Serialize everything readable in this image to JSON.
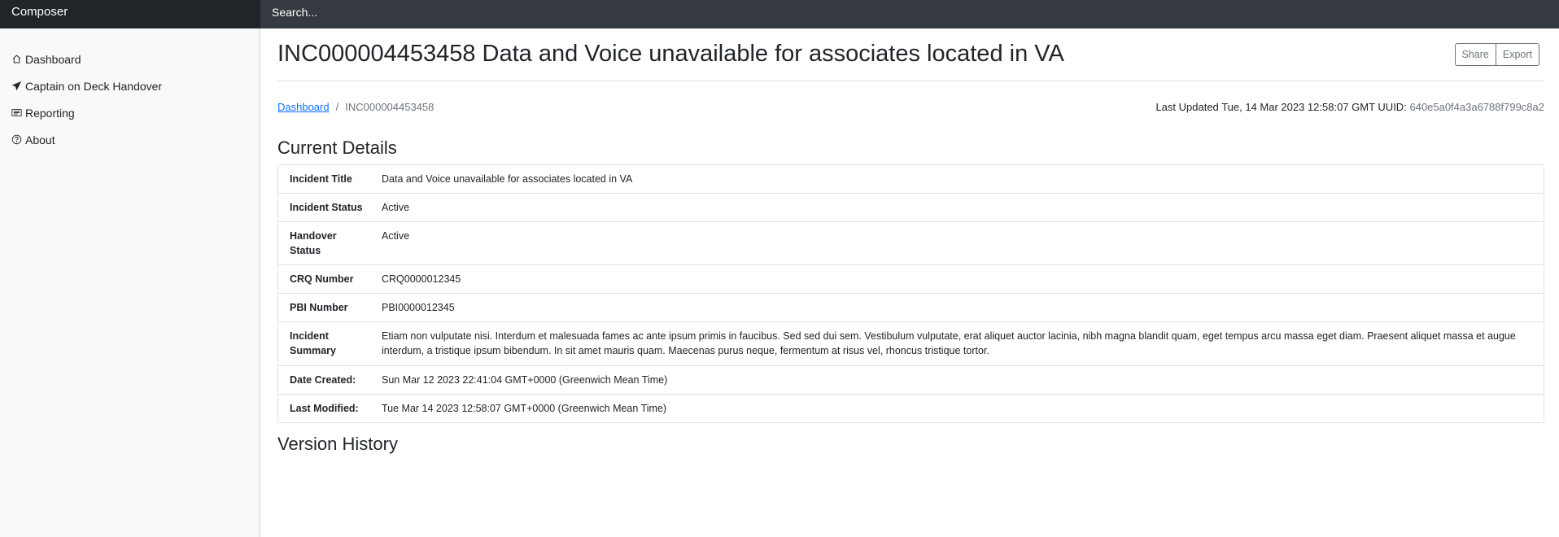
{
  "app": {
    "brand": "Composer",
    "search_placeholder": "Search..."
  },
  "sidebar": {
    "items": [
      {
        "label": "Dashboard",
        "icon": "house-icon"
      },
      {
        "label": "Captain on Deck Handover",
        "icon": "send-icon"
      },
      {
        "label": "Reporting",
        "icon": "card-text-icon"
      },
      {
        "label": "About",
        "icon": "question-circle-icon"
      }
    ]
  },
  "header": {
    "title": "INC000004453458 Data and Voice unavailable for associates located in VA",
    "share_label": "Share",
    "export_label": "Export"
  },
  "breadcrumb": {
    "root": "Dashboard",
    "separator": "/",
    "current": "INC000004453458"
  },
  "meta": {
    "last_updated_label": "Last Updated",
    "last_updated": "Tue, 14 Mar 2023 12:58:07 GMT",
    "uuid_label": "UUID:",
    "uuid": "640e5a0f4a3a6788f799c8a2"
  },
  "current_details": {
    "heading": "Current Details",
    "rows": [
      {
        "label": "Incident Title",
        "value": "Data and Voice unavailable for associates located in VA"
      },
      {
        "label": "Incident Status",
        "value": "Active"
      },
      {
        "label": "Handover Status",
        "value": "Active"
      },
      {
        "label": "CRQ Number",
        "value": "CRQ0000012345"
      },
      {
        "label": "PBI Number",
        "value": "PBI0000012345"
      },
      {
        "label": "Incident Summary",
        "value": "Etiam non vulputate nisi. Interdum et malesuada fames ac ante ipsum primis in faucibus. Sed sed dui sem. Vestibulum vulputate, erat aliquet auctor lacinia, nibh magna blandit quam, eget tempus arcu massa eget diam. Praesent aliquet massa et augue interdum, a tristique ipsum bibendum. In sit amet mauris quam. Maecenas purus neque, fermentum at risus vel, rhoncus tristique tortor."
      },
      {
        "label": "Date Created:",
        "value": "Sun Mar 12 2023 22:41:04 GMT+0000 (Greenwich Mean Time)"
      },
      {
        "label": "Last Modified:",
        "value": "Tue Mar 14 2023 12:58:07 GMT+0000 (Greenwich Mean Time)"
      }
    ]
  },
  "version_history": {
    "heading": "Version History"
  }
}
